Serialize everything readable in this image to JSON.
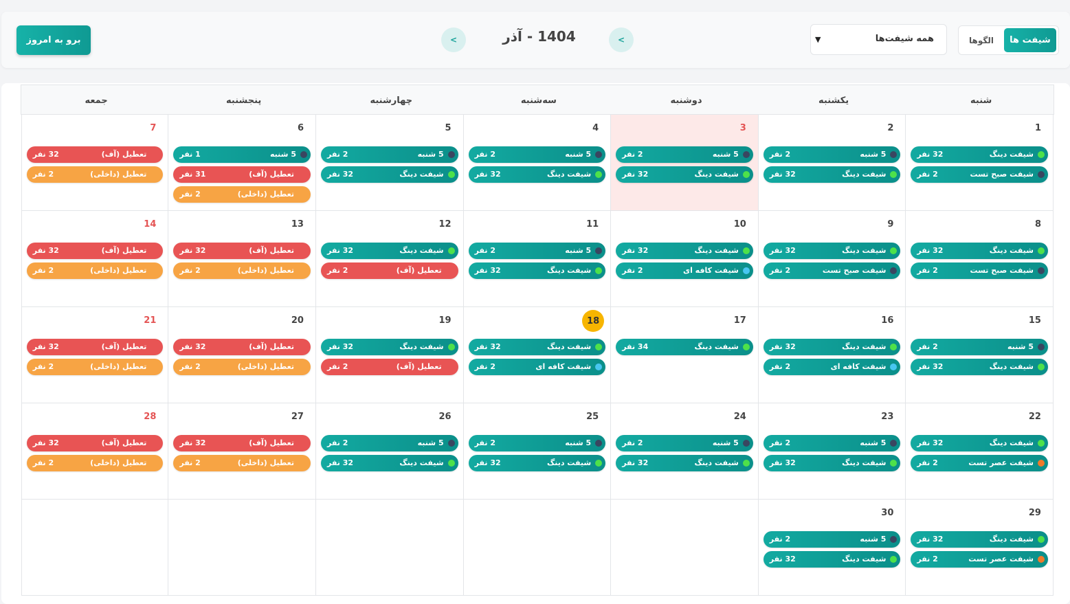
{
  "toolbar": {
    "today_label": "برو به امروز",
    "prev_label": "<",
    "next_label": "<",
    "month_title": "1404 - آذر",
    "filter_value": "همه شیفت‌ها",
    "view_shifts_label": "شیفت ها",
    "view_patterns_label": "الگوها"
  },
  "weekdays": [
    "شنبه",
    "یکشنبه",
    "دوشنبه",
    "سه‌شنبه",
    "چهارشنبه",
    "پنجشنبه",
    "جمعه"
  ],
  "colors": {
    "accent": "#13aaa1",
    "holiday_red": "#e85454",
    "holiday_orange": "#f7a444",
    "today_bg": "#fde9e8",
    "highlight_yellow": "#f7b500"
  },
  "weeks": [
    [
      {
        "day": "1",
        "events": [
          {
            "name": "شیفت دینگ",
            "count": "32 نفر",
            "style": "teal",
            "dot": "green"
          },
          {
            "name": "شیفت صبح تست",
            "count": "2 نفر",
            "style": "teal",
            "dot": "dark"
          }
        ]
      },
      {
        "day": "2",
        "events": [
          {
            "name": "5 شنبه",
            "count": "2 نفر",
            "style": "teal",
            "dot": "dark"
          },
          {
            "name": "شیفت دینگ",
            "count": "32 نفر",
            "style": "teal",
            "dot": "green"
          }
        ]
      },
      {
        "day": "3",
        "today": true,
        "red": true,
        "events": [
          {
            "name": "5 شنبه",
            "count": "2 نفر",
            "style": "teal",
            "dot": "dark"
          },
          {
            "name": "شیفت دینگ",
            "count": "32 نفر",
            "style": "teal",
            "dot": "green"
          }
        ]
      },
      {
        "day": "4",
        "events": [
          {
            "name": "5 شنبه",
            "count": "2 نفر",
            "style": "teal",
            "dot": "dark"
          },
          {
            "name": "شیفت دینگ",
            "count": "32 نفر",
            "style": "teal",
            "dot": "green"
          }
        ]
      },
      {
        "day": "5",
        "events": [
          {
            "name": "5 شنبه",
            "count": "2 نفر",
            "style": "teal",
            "dot": "dark"
          },
          {
            "name": "شیفت دینگ",
            "count": "32 نفر",
            "style": "teal",
            "dot": "green"
          }
        ]
      },
      {
        "day": "6",
        "events": [
          {
            "name": "5 شنبه",
            "count": "1 نفر",
            "style": "teal",
            "dot": "dark"
          },
          {
            "name": "تعطیل (آف)",
            "count": "31 نفر",
            "style": "red"
          },
          {
            "name": "تعطیل (داخلی)",
            "count": "2 نفر",
            "style": "orange"
          }
        ]
      },
      {
        "day": "7",
        "red": true,
        "events": [
          {
            "name": "تعطیل (آف)",
            "count": "32 نفر",
            "style": "red"
          },
          {
            "name": "تعطیل (داخلی)",
            "count": "2 نفر",
            "style": "orange"
          }
        ]
      }
    ],
    [
      {
        "day": "8",
        "events": [
          {
            "name": "شیفت دینگ",
            "count": "32 نفر",
            "style": "teal",
            "dot": "green"
          },
          {
            "name": "شیفت صبح تست",
            "count": "2 نفر",
            "style": "teal",
            "dot": "dark"
          }
        ]
      },
      {
        "day": "9",
        "events": [
          {
            "name": "شیفت دینگ",
            "count": "32 نفر",
            "style": "teal",
            "dot": "green"
          },
          {
            "name": "شیفت صبح تست",
            "count": "2 نفر",
            "style": "teal",
            "dot": "dark"
          }
        ]
      },
      {
        "day": "10",
        "events": [
          {
            "name": "شیفت دینگ",
            "count": "32 نفر",
            "style": "teal",
            "dot": "green"
          },
          {
            "name": "شیفت کافه ای",
            "count": "2 نفر",
            "style": "teal",
            "dot": "blue"
          }
        ]
      },
      {
        "day": "11",
        "events": [
          {
            "name": "5 شنبه",
            "count": "2 نفر",
            "style": "teal",
            "dot": "dark"
          },
          {
            "name": "شیفت دینگ",
            "count": "32 نفر",
            "style": "teal",
            "dot": "green"
          }
        ]
      },
      {
        "day": "12",
        "events": [
          {
            "name": "شیفت دینگ",
            "count": "32 نفر",
            "style": "teal",
            "dot": "green"
          },
          {
            "name": "تعطیل (آف)",
            "count": "2 نفر",
            "style": "red"
          }
        ]
      },
      {
        "day": "13",
        "events": [
          {
            "name": "تعطیل (آف)",
            "count": "32 نفر",
            "style": "red"
          },
          {
            "name": "تعطیل (داخلی)",
            "count": "2 نفر",
            "style": "orange"
          }
        ]
      },
      {
        "day": "14",
        "red": true,
        "events": [
          {
            "name": "تعطیل (آف)",
            "count": "32 نفر",
            "style": "red"
          },
          {
            "name": "تعطیل (داخلی)",
            "count": "2 نفر",
            "style": "orange"
          }
        ]
      }
    ],
    [
      {
        "day": "15",
        "events": [
          {
            "name": "5 شنبه",
            "count": "2 نفر",
            "style": "teal",
            "dot": "dark"
          },
          {
            "name": "شیفت دینگ",
            "count": "32 نفر",
            "style": "teal",
            "dot": "green"
          }
        ]
      },
      {
        "day": "16",
        "events": [
          {
            "name": "شیفت دینگ",
            "count": "32 نفر",
            "style": "teal",
            "dot": "green"
          },
          {
            "name": "شیفت کافه ای",
            "count": "2 نفر",
            "style": "teal",
            "dot": "blue"
          }
        ]
      },
      {
        "day": "17",
        "events": [
          {
            "name": "شیفت دینگ",
            "count": "34 نفر",
            "style": "teal",
            "dot": "green"
          }
        ]
      },
      {
        "day": "18",
        "highlight": true,
        "events": [
          {
            "name": "شیفت دینگ",
            "count": "32 نفر",
            "style": "teal",
            "dot": "green"
          },
          {
            "name": "شیفت کافه ای",
            "count": "2 نفر",
            "style": "teal",
            "dot": "blue"
          }
        ]
      },
      {
        "day": "19",
        "events": [
          {
            "name": "شیفت دینگ",
            "count": "32 نفر",
            "style": "teal",
            "dot": "green"
          },
          {
            "name": "تعطیل (آف)",
            "count": "2 نفر",
            "style": "red"
          }
        ]
      },
      {
        "day": "20",
        "events": [
          {
            "name": "تعطیل (آف)",
            "count": "32 نفر",
            "style": "red"
          },
          {
            "name": "تعطیل (داخلی)",
            "count": "2 نفر",
            "style": "orange"
          }
        ]
      },
      {
        "day": "21",
        "red": true,
        "events": [
          {
            "name": "تعطیل (آف)",
            "count": "32 نفر",
            "style": "red"
          },
          {
            "name": "تعطیل (داخلی)",
            "count": "2 نفر",
            "style": "orange"
          }
        ]
      }
    ],
    [
      {
        "day": "22",
        "events": [
          {
            "name": "شیفت دینگ",
            "count": "32 نفر",
            "style": "teal",
            "dot": "green"
          },
          {
            "name": "شیفت عصر تست",
            "count": "2 نفر",
            "style": "teal",
            "dot": "orange"
          }
        ]
      },
      {
        "day": "23",
        "events": [
          {
            "name": "5 شنبه",
            "count": "2 نفر",
            "style": "teal",
            "dot": "dark"
          },
          {
            "name": "شیفت دینگ",
            "count": "32 نفر",
            "style": "teal",
            "dot": "green"
          }
        ]
      },
      {
        "day": "24",
        "events": [
          {
            "name": "5 شنبه",
            "count": "2 نفر",
            "style": "teal",
            "dot": "dark"
          },
          {
            "name": "شیفت دینگ",
            "count": "32 نفر",
            "style": "teal",
            "dot": "green"
          }
        ]
      },
      {
        "day": "25",
        "events": [
          {
            "name": "5 شنبه",
            "count": "2 نفر",
            "style": "teal",
            "dot": "dark"
          },
          {
            "name": "شیفت دینگ",
            "count": "32 نفر",
            "style": "teal",
            "dot": "green"
          }
        ]
      },
      {
        "day": "26",
        "events": [
          {
            "name": "5 شنبه",
            "count": "2 نفر",
            "style": "teal",
            "dot": "dark"
          },
          {
            "name": "شیفت دینگ",
            "count": "32 نفر",
            "style": "teal",
            "dot": "green"
          }
        ]
      },
      {
        "day": "27",
        "events": [
          {
            "name": "تعطیل (آف)",
            "count": "32 نفر",
            "style": "red"
          },
          {
            "name": "تعطیل (داخلی)",
            "count": "2 نفر",
            "style": "orange"
          }
        ]
      },
      {
        "day": "28",
        "red": true,
        "events": [
          {
            "name": "تعطیل (آف)",
            "count": "32 نفر",
            "style": "red"
          },
          {
            "name": "تعطیل (داخلی)",
            "count": "2 نفر",
            "style": "orange"
          }
        ]
      }
    ],
    [
      {
        "day": "29",
        "events": [
          {
            "name": "شیفت دینگ",
            "count": "32 نفر",
            "style": "teal",
            "dot": "green"
          },
          {
            "name": "شیفت عصر تست",
            "count": "2 نفر",
            "style": "teal",
            "dot": "orange"
          }
        ]
      },
      {
        "day": "30",
        "events": [
          {
            "name": "5 شنبه",
            "count": "2 نفر",
            "style": "teal",
            "dot": "dark"
          },
          {
            "name": "شیفت دینگ",
            "count": "32 نفر",
            "style": "teal",
            "dot": "green"
          }
        ]
      },
      {
        "day": "",
        "events": []
      },
      {
        "day": "",
        "events": []
      },
      {
        "day": "",
        "events": []
      },
      {
        "day": "",
        "events": []
      },
      {
        "day": "",
        "events": []
      }
    ]
  ]
}
